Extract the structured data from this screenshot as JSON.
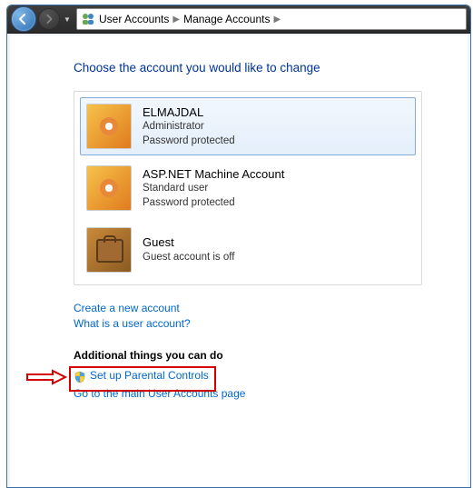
{
  "breadcrumb": {
    "item1": "User Accounts",
    "item2": "Manage Accounts"
  },
  "heading": "Choose the account you would like to change",
  "accounts": [
    {
      "name": "ELMAJDAL",
      "line1": "Administrator",
      "line2": "Password protected",
      "selected": true,
      "pic": "flower"
    },
    {
      "name": "ASP.NET Machine Account",
      "line1": "Standard user",
      "line2": "Password protected",
      "selected": false,
      "pic": "flower"
    },
    {
      "name": "Guest",
      "line1": "Guest account is off",
      "line2": "",
      "selected": false,
      "pic": "guest"
    }
  ],
  "links": {
    "create_account": "Create a new account",
    "what_is": "What is a user account?",
    "additional_heading": "Additional things you can do",
    "parental": "Set up Parental Controls",
    "goto_main": "Go to the main User Accounts page"
  }
}
